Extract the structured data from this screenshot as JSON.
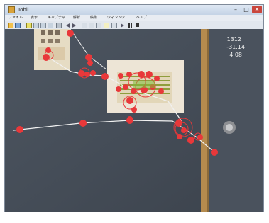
{
  "window": {
    "title": "Tobii",
    "controls": {
      "minimize": "–",
      "maximize": "□",
      "close": "✕"
    }
  },
  "menu": {
    "items": [
      "ファイル",
      "表示",
      "キャプチャ",
      "解析",
      "編集",
      "ウィンドウ",
      "ヘルプ"
    ]
  },
  "overlay": {
    "readout": [
      "1312",
      "-31.14",
      "4.08"
    ]
  },
  "icons": {
    "open": "folder-open-icon",
    "save": "save-icon",
    "play": "play-icon",
    "pause": "pause-icon",
    "stop": "stop-icon",
    "previous": "previous-icon",
    "next": "next-icon"
  },
  "colors": {
    "fixation": "#e8383a",
    "scanpath": "#f1f1f1",
    "wall": "#454d58",
    "door_frame": "#b58b4e",
    "titlebar": "#cfdbe9"
  }
}
